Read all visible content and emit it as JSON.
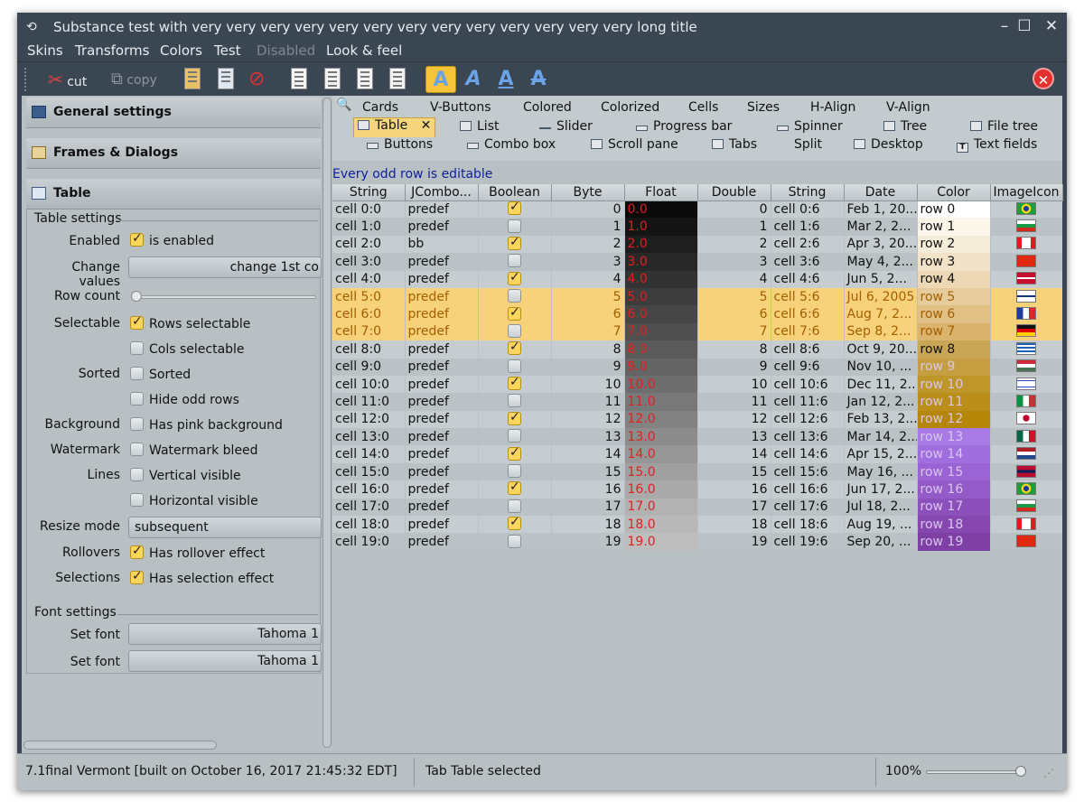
{
  "window": {
    "title": "Substance test with very very very very very very very very very very very very very long title"
  },
  "menu": [
    "Skins",
    "Transforms",
    "Colors",
    "Test",
    "Disabled",
    "Look & feel"
  ],
  "toolbar": {
    "cut": "cut",
    "copy": "copy"
  },
  "left": {
    "groups": [
      "General settings",
      "Frames & Dialogs",
      "Table"
    ],
    "table_settings": "Table settings",
    "enabled_label": "Enabled",
    "enabled_cb": "is enabled",
    "change_label": "Change values",
    "change_btn": "change 1st co",
    "rowcount_label": "Row count",
    "selectable_label": "Selectable",
    "rows_sel": "Rows selectable",
    "cols_sel": "Cols selectable",
    "sorted_label": "Sorted",
    "sorted_cb": "Sorted",
    "hide_odd": "Hide odd rows",
    "bg_label": "Background",
    "bg_cb": "Has pink background",
    "wm_label": "Watermark",
    "wm_cb": "Watermark bleed",
    "lines_label": "Lines",
    "vert": "Vertical visible",
    "horiz": "Horizontal visible",
    "resize_label": "Resize mode",
    "resize_val": "subsequent",
    "rollovers_label": "Rollovers",
    "rollover_cb": "Has rollover effect",
    "selections_label": "Selections",
    "selection_cb": "Has selection effect",
    "font_settings": "Font settings",
    "setfont1_label": "Set font",
    "setfont1_val": "Tahoma 1",
    "setfont2_label": "Set font",
    "setfont2_val": "Tahoma 1"
  },
  "tabs": {
    "row1": [
      "Cards",
      "V-Buttons",
      "Colored",
      "Colorized",
      "Cells",
      "Sizes",
      "H-Align",
      "V-Align"
    ],
    "row2": [
      "Table",
      "List",
      "Slider",
      "Progress bar",
      "Spinner",
      "Tree",
      "File tree"
    ],
    "row3": [
      "Buttons",
      "Combo box",
      "Scroll pane",
      "Tabs",
      "Split",
      "Desktop",
      "Text fields"
    ]
  },
  "note": "Every odd row is editable",
  "columns": [
    "String",
    "JCombo...",
    "Boolean",
    "Byte",
    "Float",
    "Double",
    "String",
    "Date",
    "Color",
    "ImageIcon"
  ],
  "rows": [
    {
      "s": "cell 0:0",
      "c": "predef",
      "b": true,
      "by": "0",
      "f": "0.0",
      "d": "0",
      "s2": "cell 0:6",
      "dt": "Feb 1, 20...",
      "col": "row 0",
      "fc": "#0a0a0a",
      "cc": "#ffffff",
      "flag": "br"
    },
    {
      "s": "cell 1:0",
      "c": "predef",
      "b": false,
      "by": "1",
      "f": "1.0",
      "d": "1",
      "s2": "cell 1:6",
      "dt": "Mar 2, 2...",
      "col": "row 1",
      "fc": "#141414",
      "cc": "#fbf5ea",
      "flag": "bg"
    },
    {
      "s": "cell 2:0",
      "c": "bb",
      "b": true,
      "by": "2",
      "f": "2.0",
      "d": "2",
      "s2": "cell 2:6",
      "dt": "Apr 3, 20...",
      "col": "row 2",
      "fc": "#1e1e1e",
      "cc": "#f6ecda",
      "flag": "ca"
    },
    {
      "s": "cell 3:0",
      "c": "predef",
      "b": false,
      "by": "3",
      "f": "3.0",
      "d": "3",
      "s2": "cell 3:6",
      "dt": "May 4, 2...",
      "col": "row 3",
      "fc": "#282828",
      "cc": "#f1e2c8",
      "flag": "cn"
    },
    {
      "s": "cell 4:0",
      "c": "predef",
      "b": true,
      "by": "4",
      "f": "4.0",
      "d": "4",
      "s2": "cell 4:6",
      "dt": "Jun 5, 2...",
      "col": "row 4",
      "fc": "#323232",
      "cc": "#ecd8b4",
      "flag": "dk"
    },
    {
      "s": "cell 5:0",
      "c": "predef",
      "b": false,
      "by": "5",
      "f": "5.0",
      "d": "5",
      "s2": "cell 5:6",
      "dt": "Jul 6, 2005",
      "col": "row 5",
      "fc": "#3c3c3c",
      "cc": "#e6cc9c",
      "flag": "fi",
      "sel": true
    },
    {
      "s": "cell 6:0",
      "c": "predef",
      "b": true,
      "by": "6",
      "f": "6.0",
      "d": "6",
      "s2": "cell 6:6",
      "dt": "Aug 7, 2...",
      "col": "row 6",
      "fc": "#464646",
      "cc": "#e0c084",
      "flag": "fr",
      "sel": true
    },
    {
      "s": "cell 7:0",
      "c": "predef",
      "b": false,
      "by": "7",
      "f": "7.0",
      "d": "7",
      "s2": "cell 7:6",
      "dt": "Sep 8, 2...",
      "col": "row 7",
      "fc": "#505050",
      "cc": "#dab46c",
      "flag": "de",
      "sel": true
    },
    {
      "s": "cell 8:0",
      "c": "predef",
      "b": true,
      "by": "8",
      "f": "8.0",
      "d": "8",
      "s2": "cell 8:6",
      "dt": "Oct 9, 20...",
      "col": "row 8",
      "fc": "#5a5a5a",
      "cc": "#c9a656",
      "flag": "gr"
    },
    {
      "s": "cell 9:0",
      "c": "predef",
      "b": false,
      "by": "9",
      "f": "9.0",
      "d": "9",
      "s2": "cell 9:6",
      "dt": "Nov 10, ...",
      "col": "row 9",
      "fc": "#646464",
      "cc": "#c49e40",
      "flag": "hu"
    },
    {
      "s": "cell 10:0",
      "c": "predef",
      "b": true,
      "by": "10",
      "f": "10.0",
      "d": "10",
      "s2": "cell 10:6",
      "dt": "Dec 11, 2...",
      "col": "row 10",
      "fc": "#6e6e6e",
      "cc": "#bf962a",
      "flag": "il"
    },
    {
      "s": "cell 11:0",
      "c": "predef",
      "b": false,
      "by": "11",
      "f": "11.0",
      "d": "11",
      "s2": "cell 11:6",
      "dt": "Jan 12, 2...",
      "col": "row 11",
      "fc": "#787878",
      "cc": "#ba8e18",
      "flag": "it"
    },
    {
      "s": "cell 12:0",
      "c": "predef",
      "b": true,
      "by": "12",
      "f": "12.0",
      "d": "12",
      "s2": "cell 12:6",
      "dt": "Feb 13, 2...",
      "col": "row 12",
      "fc": "#828282",
      "cc": "#b58608",
      "flag": "jp"
    },
    {
      "s": "cell 13:0",
      "c": "predef",
      "b": false,
      "by": "13",
      "f": "13.0",
      "d": "13",
      "s2": "cell 13:6",
      "dt": "Mar 14, 2...",
      "col": "row 13",
      "fc": "#8c8c8c",
      "cc": "#a77ae6",
      "flag": "mx"
    },
    {
      "s": "cell 14:0",
      "c": "predef",
      "b": true,
      "by": "14",
      "f": "14.0",
      "d": "14",
      "s2": "cell 14:6",
      "dt": "Apr 15, 2...",
      "col": "row 14",
      "fc": "#969696",
      "cc": "#a06ede",
      "flag": "nl"
    },
    {
      "s": "cell 15:0",
      "c": "predef",
      "b": false,
      "by": "15",
      "f": "15.0",
      "d": "15",
      "s2": "cell 15:6",
      "dt": "May 16, ...",
      "col": "row 15",
      "fc": "#a0a0a0",
      "cc": "#9a64d4",
      "flag": "no"
    },
    {
      "s": "cell 16:0",
      "c": "predef",
      "b": true,
      "by": "16",
      "f": "16.0",
      "d": "16",
      "s2": "cell 16:6",
      "dt": "Jun 17, 2...",
      "col": "row 16",
      "fc": "#aaaaaa",
      "cc": "#935ac8",
      "flag": "br"
    },
    {
      "s": "cell 17:0",
      "c": "predef",
      "b": false,
      "by": "17",
      "f": "17.0",
      "d": "17",
      "s2": "cell 17:6",
      "dt": "Jul 18, 2...",
      "col": "row 17",
      "fc": "#b2b2b2",
      "cc": "#8c50bc",
      "flag": "bg"
    },
    {
      "s": "cell 18:0",
      "c": "predef",
      "b": true,
      "by": "18",
      "f": "18.0",
      "d": "18",
      "s2": "cell 18:6",
      "dt": "Aug 19, ...",
      "col": "row 18",
      "fc": "#b8b8b8",
      "cc": "#8648b0",
      "flag": "ca"
    },
    {
      "s": "cell 19:0",
      "c": "predef",
      "b": false,
      "by": "19",
      "f": "19.0",
      "d": "19",
      "s2": "cell 19:6",
      "dt": "Sep 20, ...",
      "col": "row 19",
      "fc": "#bebebe",
      "cc": "#7e40a4",
      "flag": "cn"
    }
  ],
  "status": {
    "version": "7.1final Vermont [built on October 16, 2017 21:45:32 EDT]",
    "message": "Tab Table selected",
    "zoom": "100%"
  }
}
